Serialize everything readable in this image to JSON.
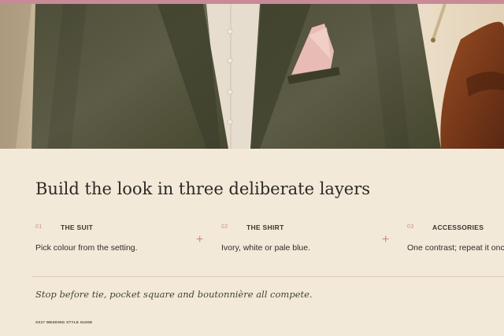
{
  "hero": {
    "image_description": "hero-photo",
    "colors": {
      "jacket": "#56553f",
      "shirt": "#e6ddcf",
      "pocket_square": "#e8bcb4",
      "shoe": "#7a3a1c",
      "backdrop": "#e4d7c0"
    }
  },
  "headline": "Build the look in three deliberate layers",
  "layers": [
    {
      "num": "01",
      "title": "THE SUIT",
      "desc": "Pick colour from the setting."
    },
    {
      "num": "02",
      "title": "THE SHIRT",
      "desc": "Ivory, white or pale blue."
    },
    {
      "num": "03",
      "title": "ACCESSORIES",
      "desc": "One contrast; repeat it once."
    }
  ],
  "plus_glyph": "+",
  "quote": "Stop before tie, pocket square and boutonnière all compete.",
  "footer_label": "SS27 WEDDING STYLE GUIDE",
  "colors": {
    "accent": "#c98a97",
    "background": "#f3e9d9",
    "text": "#2c2a24"
  }
}
